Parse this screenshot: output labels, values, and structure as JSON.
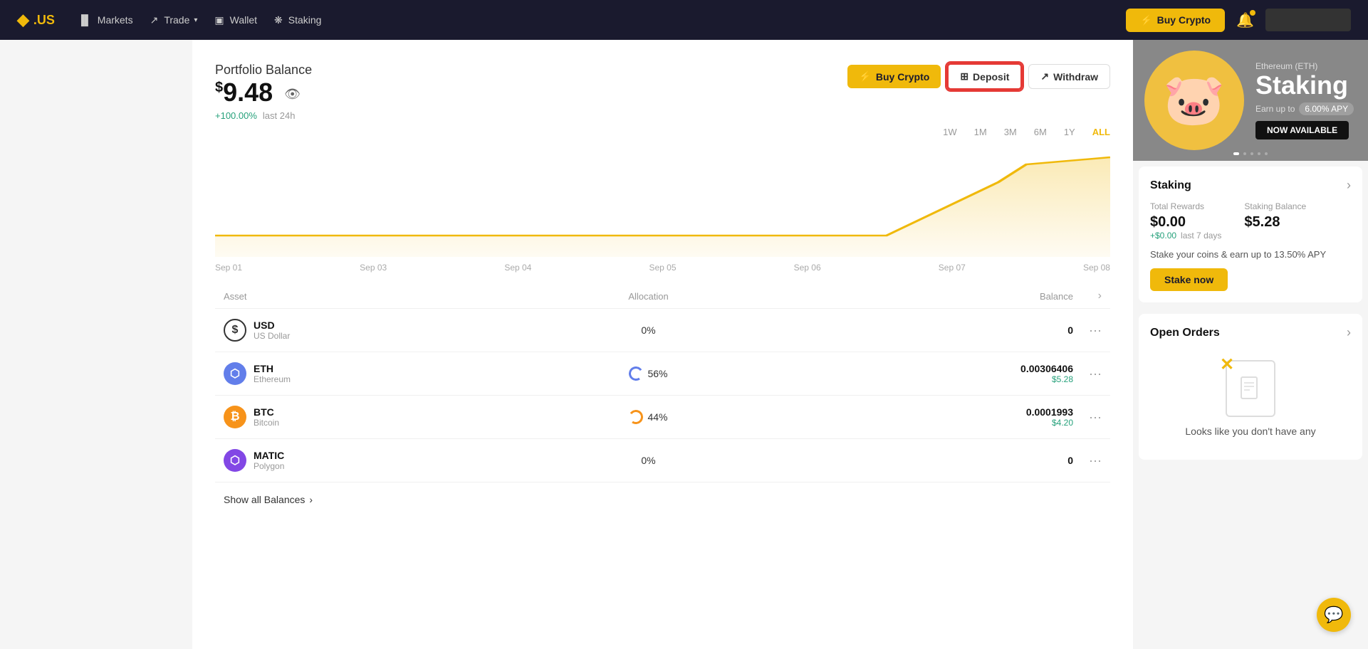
{
  "navbar": {
    "logo": "◆.US",
    "links": [
      {
        "id": "markets",
        "label": "Markets",
        "icon": "▐▌"
      },
      {
        "id": "trade",
        "label": "Trade",
        "icon": "↗",
        "has_dropdown": true
      },
      {
        "id": "wallet",
        "label": "Wallet",
        "icon": "▣"
      },
      {
        "id": "staking",
        "label": "Staking",
        "icon": "❋"
      }
    ],
    "buy_crypto_label": "Buy Crypto",
    "bell_icon": "🔔"
  },
  "portfolio": {
    "title": "Portfolio Balance",
    "balance": "9.48",
    "balance_prefix": "$",
    "change": "+100.00%",
    "change_label": "last 24h",
    "eye_icon": "👁",
    "actions": {
      "buy_crypto": "Buy Crypto",
      "deposit": "Deposit",
      "withdraw": "Withdraw"
    }
  },
  "chart": {
    "filters": [
      "1W",
      "1M",
      "3M",
      "6M",
      "1Y",
      "ALL"
    ],
    "active_filter": "1W",
    "x_labels": [
      "Sep 01",
      "Sep 03",
      "Sep 04",
      "Sep 05",
      "Sep 06",
      "Sep 07",
      "Sep 08"
    ]
  },
  "assets": {
    "headers": {
      "asset": "Asset",
      "allocation": "Allocation",
      "balance": "Balance"
    },
    "rows": [
      {
        "symbol": "USD",
        "name": "US Dollar",
        "icon_type": "usd",
        "allocation": "0%",
        "balance_primary": "0",
        "balance_secondary": ""
      },
      {
        "symbol": "ETH",
        "name": "Ethereum",
        "icon_type": "eth",
        "allocation": "56%",
        "balance_primary": "0.00306406",
        "balance_secondary": "$5.28"
      },
      {
        "symbol": "BTC",
        "name": "Bitcoin",
        "icon_type": "btc",
        "allocation": "44%",
        "balance_primary": "0.0001993",
        "balance_secondary": "$4.20"
      },
      {
        "symbol": "MATIC",
        "name": "Polygon",
        "icon_type": "matic",
        "allocation": "0%",
        "balance_primary": "0",
        "balance_secondary": ""
      }
    ],
    "show_all_label": "Show all Balances"
  },
  "right_sidebar": {
    "banner": {
      "subtitle": "Ethereum (ETH)",
      "title": "Staking",
      "earn_text": "Earn up to",
      "apy": "6.00% APY",
      "available_label": "NOW AVAILABLE"
    },
    "staking": {
      "title": "Staking",
      "total_rewards_label": "Total Rewards",
      "total_rewards": "$0.00",
      "total_rewards_change": "+$0.00",
      "total_rewards_period": "last 7 days",
      "staking_balance_label": "Staking Balance",
      "staking_balance": "$5.28",
      "stake_text": "Stake your coins & earn up to 13.50% APY",
      "stake_btn": "Stake now"
    },
    "open_orders": {
      "title": "Open Orders",
      "empty_text": "Looks like you don't have any"
    }
  },
  "chat_fab_icon": "💬"
}
